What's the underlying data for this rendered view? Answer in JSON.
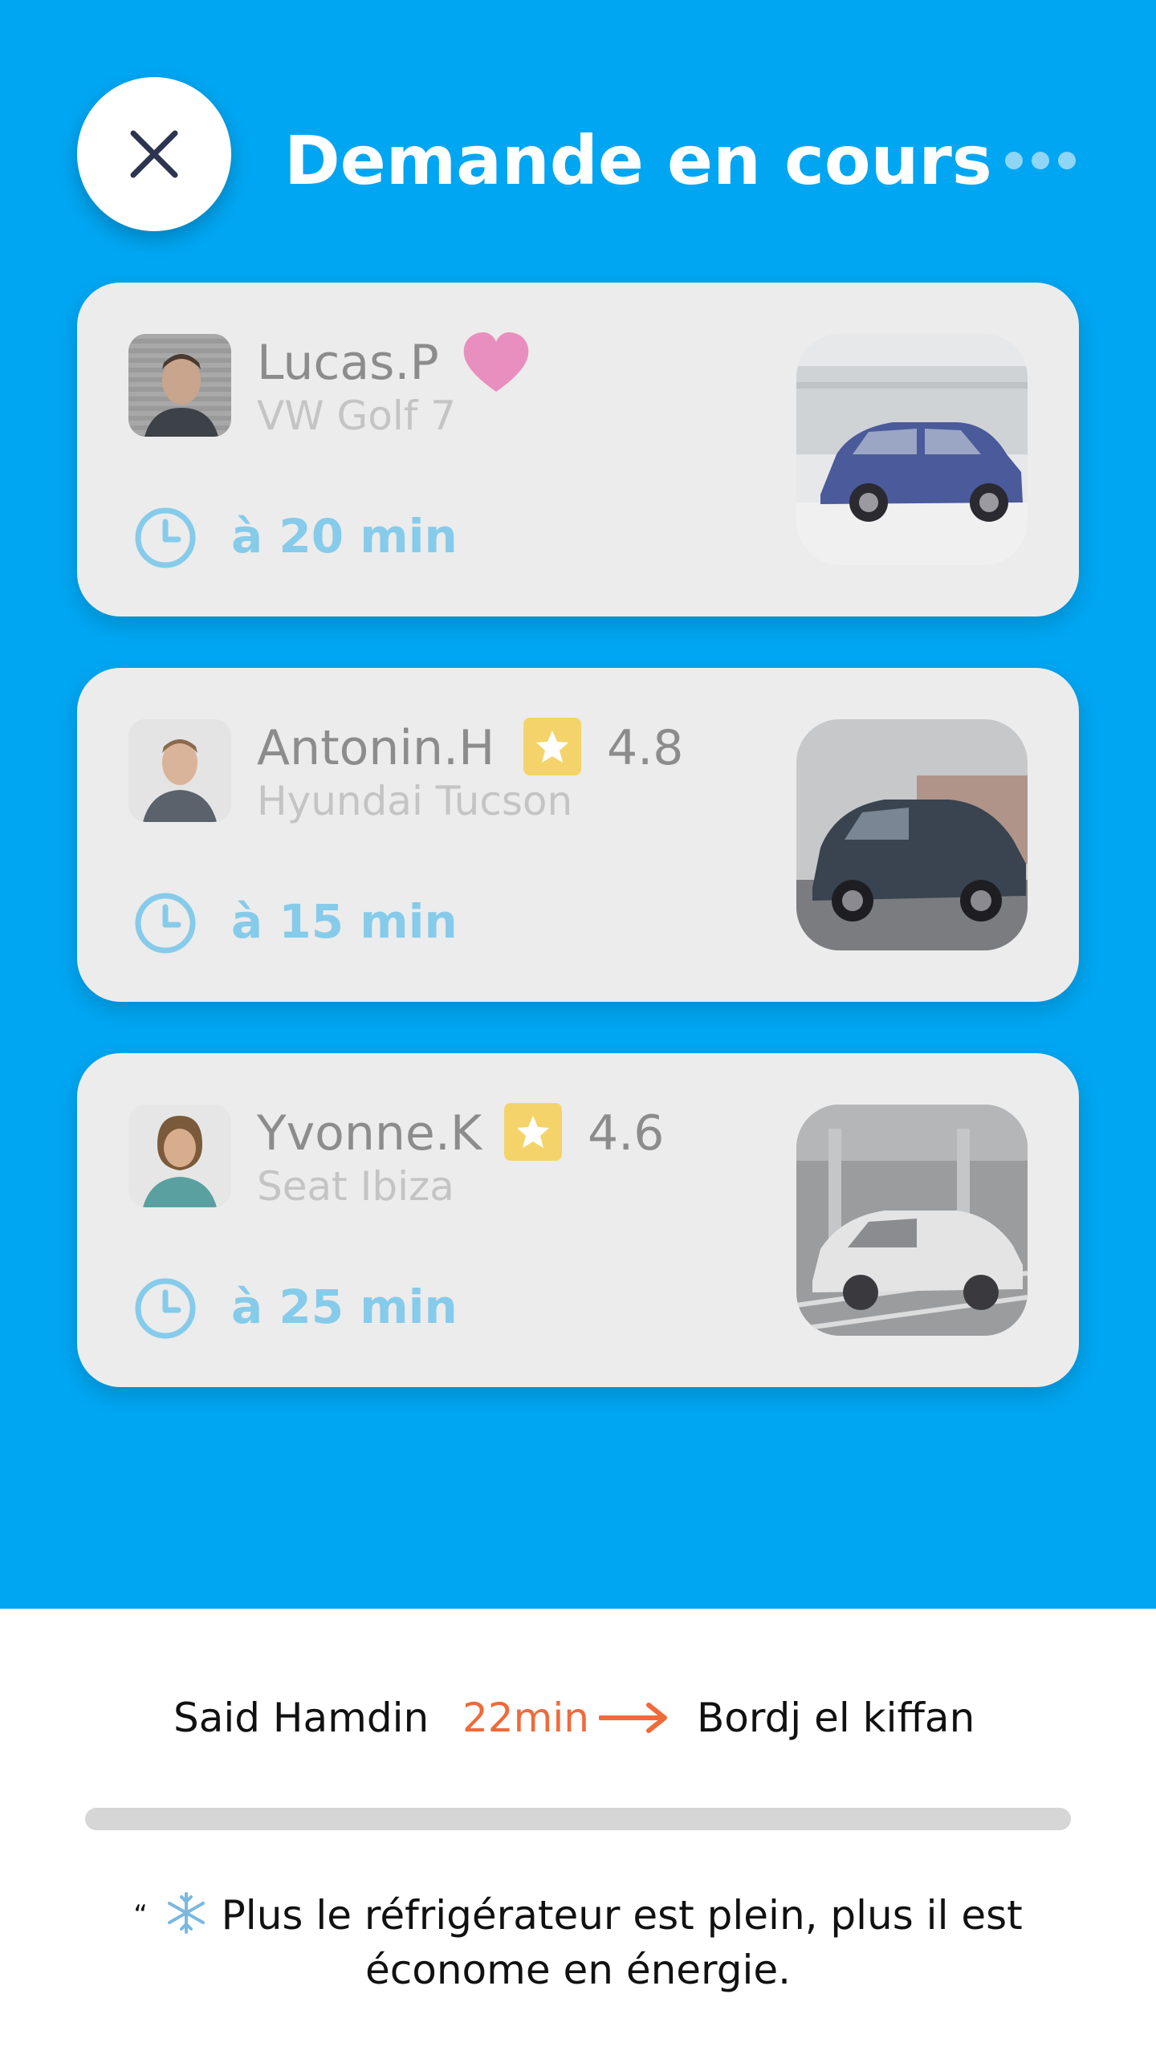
{
  "header": {
    "title": "Demande en cours",
    "close_icon": "close-icon",
    "more_icon": "more-dots-icon"
  },
  "drivers": [
    {
      "name": "Lucas.P",
      "car": "VW Golf 7",
      "eta": "à 20 min",
      "badge": "favorite-heart"
    },
    {
      "name": "Antonin.H",
      "car": "Hyundai Tucson",
      "eta": "à 15 min",
      "badge": "star",
      "rating": "4.8"
    },
    {
      "name": "Yvonne.K",
      "car": "Seat Ibiza",
      "eta": "à 25 min",
      "badge": "star",
      "rating": "4.6"
    }
  ],
  "trip": {
    "from": "Said Hamdin",
    "duration": "22min",
    "to": "Bordj el kiffan",
    "progress": 0.0
  },
  "tip": {
    "quote_mark": "“",
    "icon": "snowflake",
    "text": "Plus le réfrigérateur est plein, plus il est économe en énergie."
  },
  "colors": {
    "background": "#00a6f2",
    "card": "#ececec",
    "eta": "#86cbea",
    "duration": "#f06a3a",
    "heart": "#e88fbf",
    "star_badge": "#f4d46a"
  }
}
